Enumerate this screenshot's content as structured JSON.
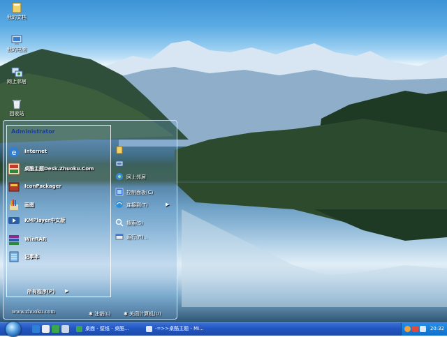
{
  "desktop": {
    "icons": [
      {
        "label": "我的文档",
        "icon": "my-documents-icon"
      },
      {
        "label": "我的电脑",
        "icon": "my-computer-icon"
      },
      {
        "label": "网上邻居",
        "icon": "network-places-icon"
      },
      {
        "label": "回收站",
        "icon": "recycle-bin-icon"
      }
    ]
  },
  "start_menu": {
    "user": "Administrator",
    "programs": [
      {
        "label": "Internet",
        "icon": "internet-explorer-icon"
      },
      {
        "label": "桌酷主题Desk.Zhuoku.Com",
        "icon": "zhuoku-theme-icon"
      },
      {
        "label": "IconPackager",
        "icon": "iconpackager-icon"
      },
      {
        "label": "画图",
        "icon": "paint-icon"
      },
      {
        "label": "KMPlayer中文版",
        "icon": "kmplayer-icon"
      },
      {
        "label": "WinRAR",
        "icon": "winrar-icon"
      },
      {
        "label": "记事本",
        "icon": "notepad-icon"
      }
    ],
    "all_programs": "所有程序(P)",
    "all_programs_arrow": "▶",
    "right_items": [
      {
        "label": "",
        "icon": "my-documents-icon"
      },
      {
        "label": "",
        "icon": "my-computer-icon"
      },
      {
        "label": "网上邻居",
        "icon": "network-places-icon"
      },
      {
        "label": "控制面板(C)",
        "icon": "control-panel-icon"
      },
      {
        "label": "连接到(T)",
        "icon": "connect-to-icon"
      },
      {
        "label": "搜索(S)",
        "icon": "search-icon"
      },
      {
        "label": "运行(R)...",
        "icon": "run-icon"
      }
    ],
    "connect_arrow": "▶",
    "footer_url": "www.zhuoku.com",
    "logoff": "注销(L)",
    "shutdown": "关闭计算机(U)"
  },
  "taskbar": {
    "tasks": [
      {
        "label": "桌面 - 壁纸 - 桌酷...",
        "icon": "folder-window-icon"
      },
      {
        "label": "-=>>桌酷主题 - Mi...",
        "icon": "window-icon"
      }
    ],
    "clock": "20:32"
  },
  "colors": {
    "taskbar": "#2457c4",
    "tray": "#0f6fcc",
    "user_name": "#1a3f9a"
  }
}
